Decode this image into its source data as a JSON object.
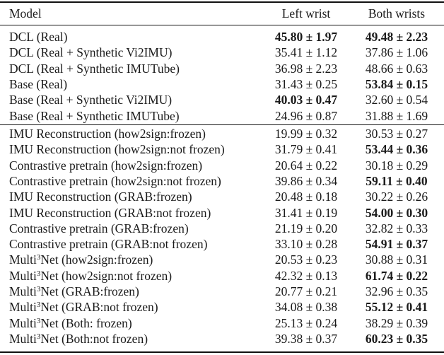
{
  "table": {
    "headers": {
      "model": "Model",
      "left": "Left wrist",
      "both": "Both wrists"
    },
    "groups": [
      {
        "rows": [
          {
            "model": "DCL (Real)",
            "left": "45.80 ± 1.97",
            "left_bold": true,
            "both": "49.48 ± 2.23",
            "both_bold": true
          },
          {
            "model": "DCL (Real + Synthetic Vi2IMU)",
            "left": "35.41 ± 1.12",
            "left_bold": false,
            "both": "37.86 ± 1.06",
            "both_bold": false
          },
          {
            "model": "DCL (Real + Synthetic IMUTube)",
            "left": "36.98 ± 2.23",
            "left_bold": false,
            "both": "48.66 ± 0.63",
            "both_bold": false
          },
          {
            "model": "Base (Real)",
            "left": "31.43 ± 0.25",
            "left_bold": false,
            "both": "53.84 ± 0.15",
            "both_bold": true
          },
          {
            "model": "Base (Real + Synthetic Vi2IMU)",
            "left": "40.03 ± 0.47",
            "left_bold": true,
            "both": "32.60 ± 0.54",
            "both_bold": false
          },
          {
            "model": "Base (Real + Synthetic IMUTube)",
            "left": "24.96 ± 0.87",
            "left_bold": false,
            "both": "31.88 ± 1.69",
            "both_bold": false
          }
        ]
      },
      {
        "rows": [
          {
            "model": "IMU Reconstruction (how2sign:frozen)",
            "left": "19.99 ± 0.32",
            "left_bold": false,
            "both": "30.53 ± 0.27",
            "both_bold": false
          },
          {
            "model": "IMU Reconstruction (how2sign:not frozen)",
            "left": "31.79 ± 0.41",
            "left_bold": false,
            "both": "53.44 ± 0.36",
            "both_bold": true
          },
          {
            "model": "Contrastive pretrain (how2sign:frozen)",
            "left": "20.64 ± 0.22",
            "left_bold": false,
            "both": "30.18 ± 0.29",
            "both_bold": false
          },
          {
            "model": "Contrastive pretrain (how2sign:not frozen)",
            "left": "39.86 ± 0.34",
            "left_bold": false,
            "both": "59.11 ± 0.40",
            "both_bold": true
          },
          {
            "model": "IMU Reconstruction (GRAB:frozen)",
            "left": "20.48 ± 0.18",
            "left_bold": false,
            "both": "30.22 ± 0.26",
            "both_bold": false
          },
          {
            "model": "IMU Reconstruction (GRAB:not frozen)",
            "left": "31.41 ± 0.19",
            "left_bold": false,
            "both": "54.00 ± 0.30",
            "both_bold": true
          },
          {
            "model": "Contrastive pretrain (GRAB:frozen)",
            "left": "21.19 ± 0.20",
            "left_bold": false,
            "both": "32.82 ± 0.33",
            "both_bold": false
          },
          {
            "model": "Contrastive pretrain (GRAB:not frozen)",
            "left": "33.10 ± 0.28",
            "left_bold": false,
            "both": "54.91 ± 0.37",
            "both_bold": true
          },
          {
            "model_base": "Multi",
            "model_sup": "3",
            "model_rest": "Net (how2sign:frozen)",
            "left": "20.53 ± 0.23",
            "left_bold": false,
            "both": "30.88 ± 0.31",
            "both_bold": false
          },
          {
            "model_base": "Multi",
            "model_sup": "3",
            "model_rest": "Net (how2sign:not frozen)",
            "left": "42.32 ± 0.13",
            "left_bold": false,
            "both": "61.74 ± 0.22",
            "both_bold": true
          },
          {
            "model_base": "Multi",
            "model_sup": "3",
            "model_rest": "Net (GRAB:frozen)",
            "left": "20.77 ± 0.21",
            "left_bold": false,
            "both": "32.96 ± 0.35",
            "both_bold": false
          },
          {
            "model_base": "Multi",
            "model_sup": "3",
            "model_rest": "Net (GRAB:not frozen)",
            "left": "34.08 ± 0.38",
            "left_bold": false,
            "both": "55.12 ± 0.41",
            "both_bold": true
          },
          {
            "model_base": "Multi",
            "model_sup": "3",
            "model_rest": "Net (Both: frozen)",
            "left": "25.13 ± 0.24",
            "left_bold": false,
            "both": "38.29 ± 0.39",
            "both_bold": false
          },
          {
            "model_base": "Multi",
            "model_sup": "3",
            "model_rest": "Net (Both:not frozen)",
            "left": "39.38 ± 0.37",
            "left_bold": false,
            "both": "60.23 ± 0.35",
            "both_bold": true
          }
        ]
      }
    ]
  }
}
